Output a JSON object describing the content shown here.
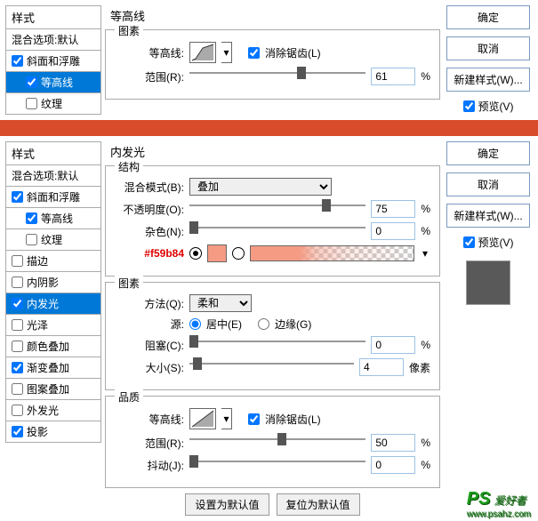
{
  "top": {
    "stylesHeader": "样式",
    "blendOptions": "混合选项:默认",
    "items": {
      "bevel": "斜面和浮雕",
      "contour": "等高线",
      "texture": "纹理"
    },
    "centerHeading": "等高线",
    "pattern": {
      "legend": "图素",
      "contourLabel": "等高线:",
      "antiAlias": "消除锯齿(L)",
      "rangeLabel": "范围(R):",
      "rangeVal": "61",
      "pct": "%"
    },
    "buttons": {
      "ok": "确定",
      "cancel": "取消",
      "newStyle": "新建样式(W)...",
      "preview": "预览(V)"
    }
  },
  "bottom": {
    "stylesHeader": "样式",
    "blendOptions": "混合选项:默认",
    "items": {
      "bevel": "斜面和浮雕",
      "contour": "等高线",
      "texture": "纹理",
      "stroke": "描边",
      "innerShadow": "内阴影",
      "innerGlow": "内发光",
      "gloss": "光泽",
      "colorOverlay": "颜色叠加",
      "gradOverlay": "渐变叠加",
      "patternOverlay": "图案叠加",
      "outerGlow": "外发光",
      "dropShadow": "投影"
    },
    "centerHeading": "内发光",
    "structure": {
      "legend": "结构",
      "blendModeLabel": "混合模式(B):",
      "blendModeVal": "叠加",
      "opacityLabel": "不透明度(O):",
      "opacityVal": "75",
      "noiseLabel": "杂色(N):",
      "noiseVal": "0",
      "pct": "%",
      "colorCallout": "#f59b84"
    },
    "pattern": {
      "legend": "图素",
      "methodLabel": "方法(Q):",
      "methodVal": "柔和",
      "sourceLabel": "源:",
      "sourceCenter": "居中(E)",
      "sourceEdge": "边缘(G)",
      "chokeLabel": "阻塞(C):",
      "chokeVal": "0",
      "sizeLabel": "大小(S):",
      "sizeVal": "4",
      "sizeUnit": "像素",
      "pct": "%"
    },
    "quality": {
      "legend": "品质",
      "contourLabel": "等高线:",
      "antiAlias": "消除锯齿(L)",
      "rangeLabel": "范围(R):",
      "rangeVal": "50",
      "jitterLabel": "抖动(J):",
      "jitterVal": "0",
      "pct": "%"
    },
    "footer": {
      "setDefault": "设置为默认值",
      "resetDefault": "复位为默认值"
    },
    "buttons": {
      "ok": "确定",
      "cancel": "取消",
      "newStyle": "新建样式(W)...",
      "preview": "预览(V)"
    }
  },
  "watermark": {
    "ps": "PS",
    "text": "爱好者",
    "url": "www.psahz.com"
  }
}
